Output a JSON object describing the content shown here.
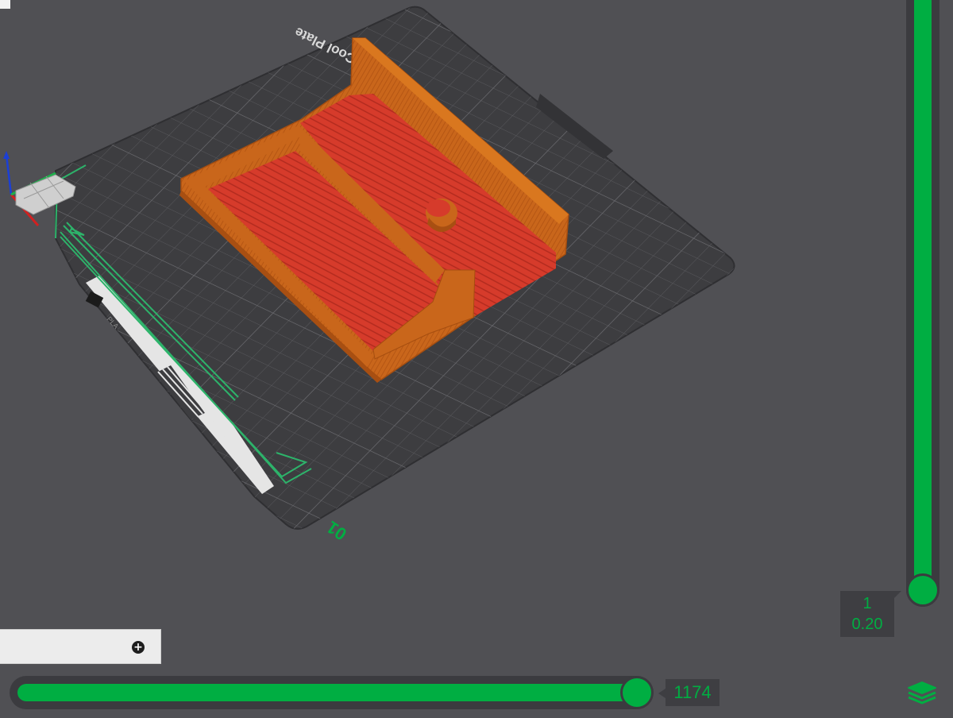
{
  "viewport": {
    "plate_label": "Bambu Cool Plate",
    "plate_number": "01",
    "plate_sticker_text": "GLUE STICK CAN HELP",
    "plate_sticker_material": "PLA",
    "background_color": "#505054",
    "plate_color": "#3d3d40",
    "model_wall_color": "#c8641a",
    "model_infill_color": "#d63b2b",
    "skirt_color": "#2db36a"
  },
  "legend_panel": {
    "expand_icon": "plus-circle-icon"
  },
  "move_slider": {
    "value": "1174",
    "position_fraction": 1.0,
    "accent": "#00ae42"
  },
  "layer_slider": {
    "layer": "1",
    "height": "0.20",
    "position_fraction": 1.0,
    "accent": "#00ae42"
  },
  "layers_button": {
    "icon": "layers-icon"
  }
}
